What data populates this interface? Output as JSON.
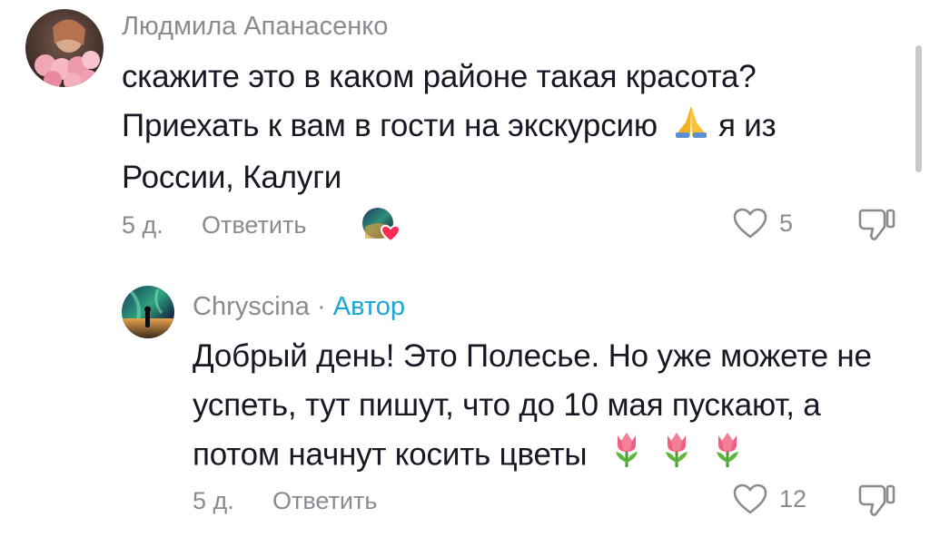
{
  "comments": [
    {
      "username": "Людмила Апанасенко",
      "lines": [
        "скажите это в каком районе такая красота?",
        "Приехать к вам в гости на экскурсию",
        "я из",
        "России, Калуги"
      ],
      "time": "5 д.",
      "reply_label": "Ответить",
      "likes": "5",
      "avatar_icon": "rose-avatar",
      "creator_liked_icon": "creator-liked-heart-icon"
    },
    {
      "username": "Chryscina",
      "separator": "·",
      "author_label": "Автор",
      "lines": [
        "Добрый день! Это Полесье. Но уже можете не",
        "успеть, тут пишут, что до 10 мая пускают, а",
        "потом начнут косить цветы"
      ],
      "time": "5 д.",
      "reply_label": "Ответить",
      "likes": "12",
      "avatar_icon": "aurora-avatar"
    }
  ],
  "colors": {
    "text_primary": "#161823",
    "text_secondary": "#8a8b91",
    "author_accent": "#1aa6d6",
    "heart_red": "#fe2c55"
  }
}
